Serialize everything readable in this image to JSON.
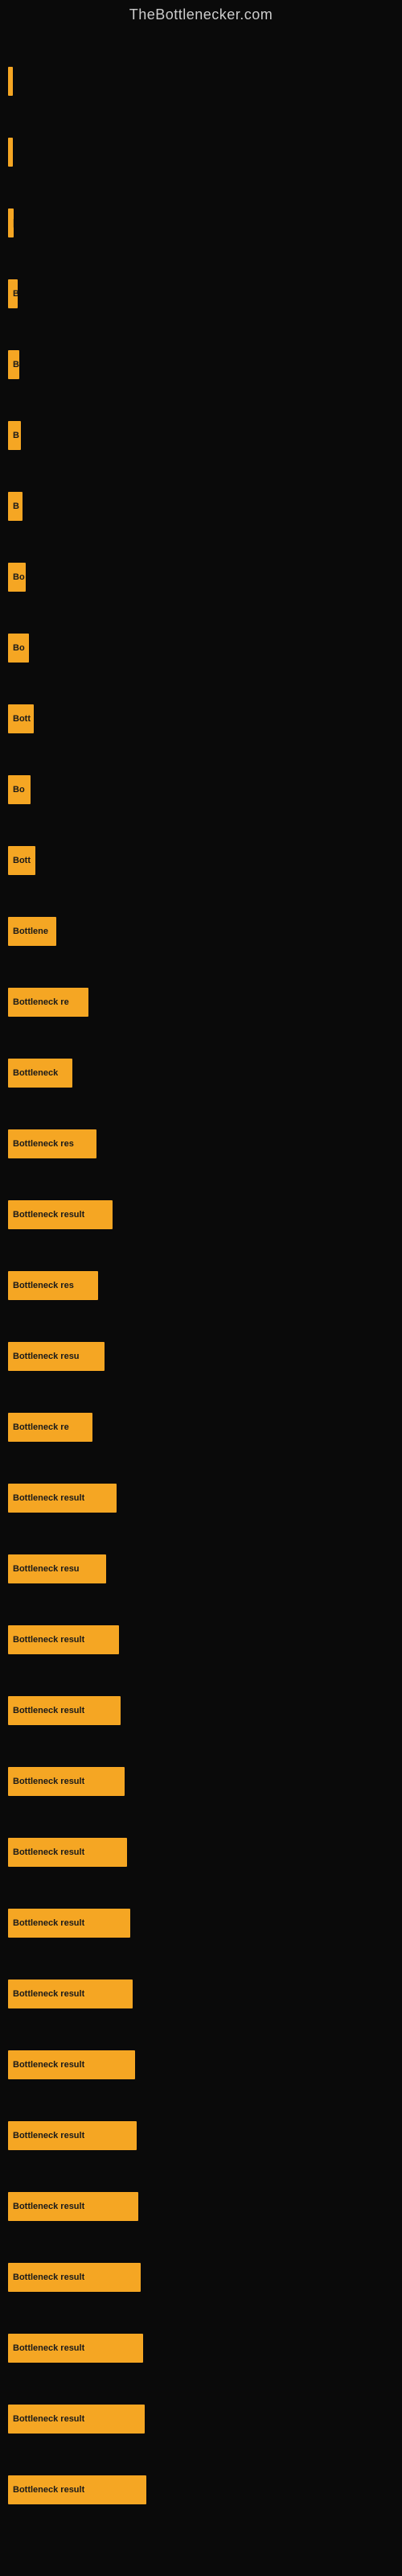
{
  "site": {
    "title": "TheBottlenecker.com"
  },
  "bars": [
    {
      "label": "|",
      "width": 4
    },
    {
      "label": "|",
      "width": 6
    },
    {
      "label": "|",
      "width": 7
    },
    {
      "label": "B",
      "width": 12
    },
    {
      "label": "B",
      "width": 14
    },
    {
      "label": "B",
      "width": 16
    },
    {
      "label": "B",
      "width": 18
    },
    {
      "label": "Bo",
      "width": 22
    },
    {
      "label": "Bo",
      "width": 26
    },
    {
      "label": "Bott",
      "width": 32
    },
    {
      "label": "Bo",
      "width": 28
    },
    {
      "label": "Bott",
      "width": 34
    },
    {
      "label": "Bottlene",
      "width": 60
    },
    {
      "label": "Bottleneck re",
      "width": 100
    },
    {
      "label": "Bottleneck",
      "width": 80
    },
    {
      "label": "Bottleneck res",
      "width": 110
    },
    {
      "label": "Bottleneck result",
      "width": 130
    },
    {
      "label": "Bottleneck res",
      "width": 112
    },
    {
      "label": "Bottleneck resu",
      "width": 120
    },
    {
      "label": "Bottleneck re",
      "width": 105
    },
    {
      "label": "Bottleneck result",
      "width": 135
    },
    {
      "label": "Bottleneck resu",
      "width": 122
    },
    {
      "label": "Bottleneck result",
      "width": 138
    },
    {
      "label": "Bottleneck result",
      "width": 140
    },
    {
      "label": "Bottleneck result",
      "width": 145
    },
    {
      "label": "Bottleneck result",
      "width": 148
    },
    {
      "label": "Bottleneck result",
      "width": 152
    },
    {
      "label": "Bottleneck result",
      "width": 155
    },
    {
      "label": "Bottleneck result",
      "width": 158
    },
    {
      "label": "Bottleneck result",
      "width": 160
    },
    {
      "label": "Bottleneck result",
      "width": 162
    },
    {
      "label": "Bottleneck result",
      "width": 165
    },
    {
      "label": "Bottleneck result",
      "width": 168
    },
    {
      "label": "Bottleneck result",
      "width": 170
    },
    {
      "label": "Bottleneck result",
      "width": 172
    }
  ]
}
